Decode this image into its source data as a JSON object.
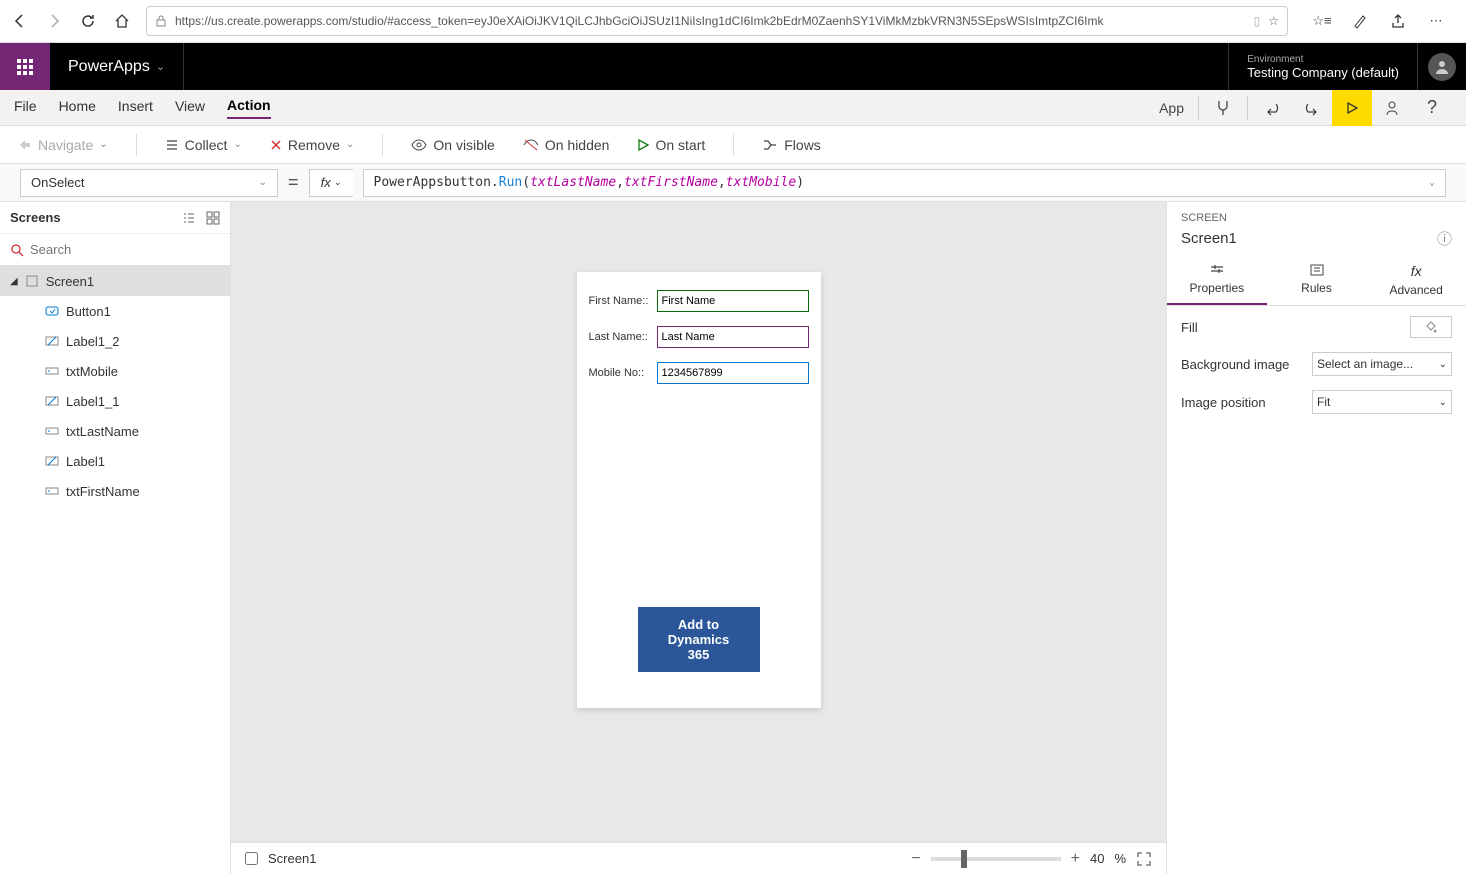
{
  "browser": {
    "url": "https://us.create.powerapps.com/studio/#access_token=eyJ0eXAiOiJKV1QiLCJhbGciOiJSUzI1NiIsIng1dCI6Imk2bEdrM0ZaenhSY1ViMkMzbkVRN3N5SEpsWSIsImtpZCI6Imk"
  },
  "app": {
    "title": "PowerApps",
    "env_label": "Environment",
    "env_name": "Testing Company (default)"
  },
  "ribbon": {
    "items": [
      "File",
      "Home",
      "Insert",
      "View",
      "Action"
    ],
    "active": "Action",
    "app_label": "App"
  },
  "action_bar": {
    "navigate": "Navigate",
    "collect": "Collect",
    "remove": "Remove",
    "on_visible": "On visible",
    "on_hidden": "On hidden",
    "on_start": "On start",
    "flows": "Flows"
  },
  "formula": {
    "property": "OnSelect",
    "fx": "fx",
    "fn_name": "PowerAppsbutton",
    "method": "Run",
    "args": [
      "txtLastName",
      "txtFirstName",
      "txtMobile"
    ]
  },
  "tree": {
    "header": "Screens",
    "search_placeholder": "Search",
    "screen": "Screen1",
    "items": [
      {
        "name": "Button1",
        "icon": "button"
      },
      {
        "name": "Label1_2",
        "icon": "label"
      },
      {
        "name": "txtMobile",
        "icon": "text"
      },
      {
        "name": "Label1_1",
        "icon": "label"
      },
      {
        "name": "txtLastName",
        "icon": "text"
      },
      {
        "name": "Label1",
        "icon": "label"
      },
      {
        "name": "txtFirstName",
        "icon": "text"
      }
    ]
  },
  "canvas": {
    "first_name_label": "First Name::",
    "last_name_label": "Last Name::",
    "mobile_label": "Mobile No::",
    "first_name_value": "First Name",
    "last_name_value": "Last Name",
    "mobile_value": "1234567899",
    "add_button": "Add to Dynamics 365",
    "footer_screen": "Screen1",
    "zoom": "40",
    "zoom_pct": "%"
  },
  "right": {
    "section": "SCREEN",
    "title": "Screen1",
    "tabs": {
      "properties": "Properties",
      "rules": "Rules",
      "advanced": "Advanced"
    },
    "props": {
      "fill": "Fill",
      "bg": "Background image",
      "bg_val": "Select an image...",
      "pos": "Image position",
      "pos_val": "Fit"
    }
  }
}
